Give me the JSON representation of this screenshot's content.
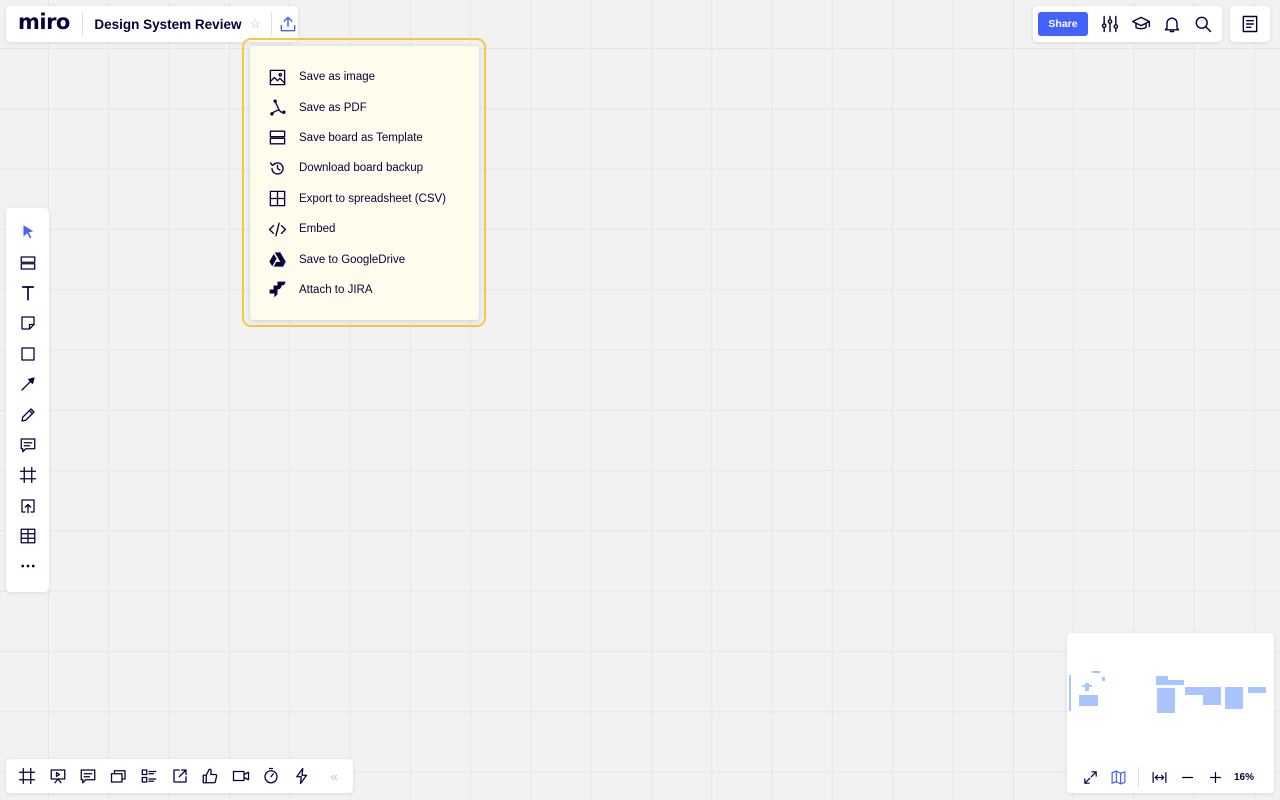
{
  "app": {
    "logo": "miro",
    "board_title": "Design System Review"
  },
  "header": {
    "star_icon": "star-outline-icon",
    "export_icon": "upload-icon",
    "share_label": "Share",
    "right_icons": [
      "settings-sliders-icon",
      "learning-cap-icon",
      "bell-icon",
      "search-icon"
    ],
    "notes_icon": "notes-icon"
  },
  "export_menu": {
    "highlight_color": "#f5c842",
    "background": "#fffcee",
    "items": [
      {
        "label": "Save as image",
        "icon": "image-icon"
      },
      {
        "label": "Save as PDF",
        "icon": "pdf-icon"
      },
      {
        "label": "Save board as Template",
        "icon": "template-icon"
      },
      {
        "label": "Download board backup",
        "icon": "backup-icon"
      },
      {
        "label": "Export to spreadsheet (CSV)",
        "icon": "table-icon"
      },
      {
        "label": "Embed",
        "icon": "code-icon"
      },
      {
        "label": "Save to GoogleDrive",
        "icon": "google-drive-icon"
      },
      {
        "label": "Attach to JIRA",
        "icon": "jira-icon"
      }
    ]
  },
  "left_toolbar": {
    "tools": [
      "select-icon",
      "templates-icon",
      "text-icon",
      "sticky-note-icon",
      "shape-icon",
      "connection-line-icon",
      "pen-icon",
      "comment-icon",
      "frame-icon",
      "upload-icon",
      "table-icon",
      "more-icon"
    ],
    "active_color": "#4262ff"
  },
  "bottom_toolbar": {
    "tools": [
      "frames-icon",
      "presentation-icon",
      "comments-icon",
      "cards-icon",
      "tasks-icon",
      "share-screen-icon",
      "voting-icon",
      "video-chat-icon",
      "timer-icon",
      "apps-icon"
    ],
    "collapse_icon": "«"
  },
  "minimap": {
    "fit_icon": "fit-screen-icon",
    "map_icon": "map-icon",
    "fit_width_icon": "fit-width-icon",
    "zoom_out_icon": "minus-icon",
    "zoom_in_icon": "plus-icon",
    "zoom_level": "16%",
    "content_color": "#a9c4ff"
  },
  "colors": {
    "accent": "#4262ff",
    "ink": "#050038",
    "canvas": "#f2f2f2"
  }
}
